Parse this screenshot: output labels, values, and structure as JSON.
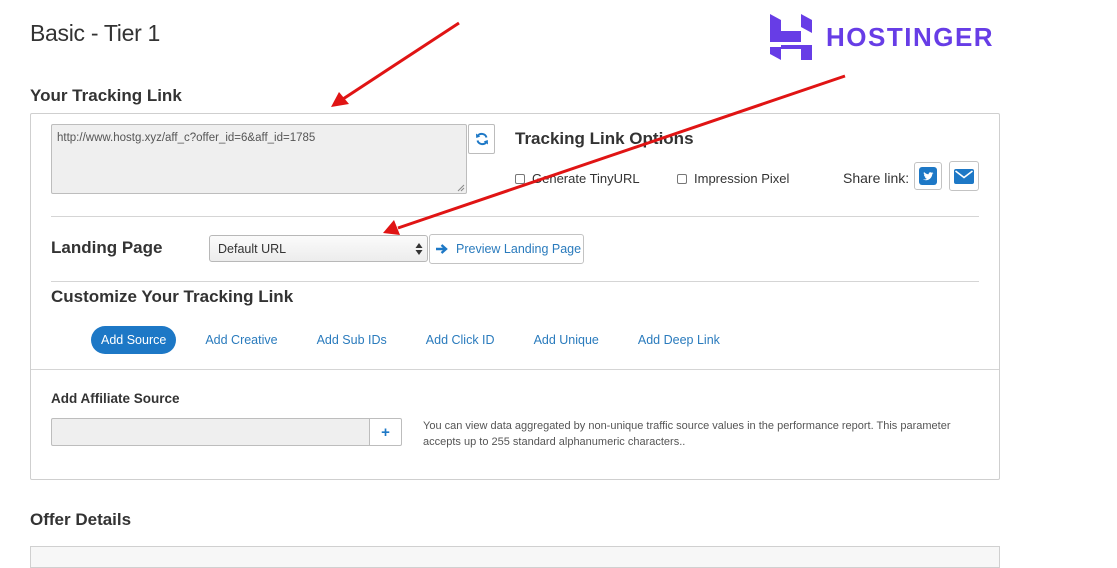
{
  "page": {
    "title": "Basic - Tier 1",
    "logo_text": "HOSTINGER",
    "brand_color": "#673de6"
  },
  "tracking": {
    "heading": "Your Tracking Link",
    "link_value": "http://www.hostg.xyz/aff_c?offer_id=6&aff_id=1785",
    "refresh_icon": "refresh-icon",
    "options_heading": "Tracking Link Options",
    "options": [
      {
        "label": "Generate TinyURL",
        "checked": false
      },
      {
        "label": "Impression Pixel",
        "checked": false
      }
    ],
    "share_label": "Share link:",
    "share_icons": [
      "twitter-icon",
      "email-icon"
    ]
  },
  "landing": {
    "label": "Landing Page",
    "selected": "Default URL",
    "preview_label": "Preview Landing Page"
  },
  "customize": {
    "heading": "Customize Your Tracking Link",
    "tabs": [
      "Add Source",
      "Add Creative",
      "Add Sub IDs",
      "Add Click ID",
      "Add Unique",
      "Add Deep Link"
    ],
    "active_tab": "Add Source"
  },
  "source": {
    "heading": "Add Affiliate Source",
    "input_value": "",
    "add_label": "+",
    "help_text": "You can view data aggregated by non-unique traffic source values in the performance report. This parameter accepts up to 255 standard alphanumeric characters.."
  },
  "offer": {
    "heading": "Offer Details"
  },
  "colors": {
    "accent": "#1d78c6",
    "link": "#2a7bbd",
    "annotation_arrow": "#e01414"
  }
}
